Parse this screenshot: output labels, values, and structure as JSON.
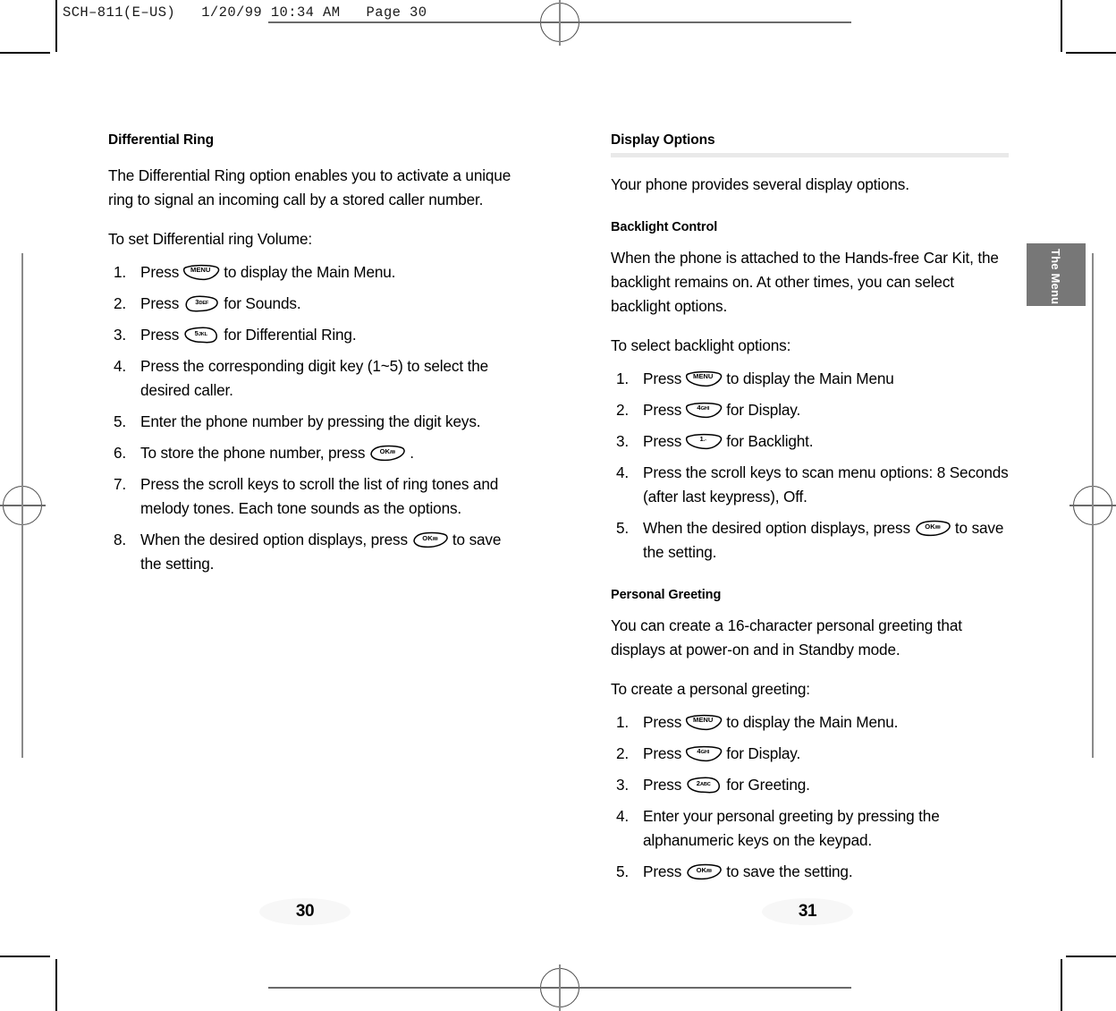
{
  "slug": "SCH–811(E–US)   1/20/99 10:34 AM   Page 30",
  "side_tab": {
    "label": "The Menu",
    "color": "#777777"
  },
  "folios": {
    "left": "30",
    "right": "31"
  },
  "keys": {
    "menu": {
      "main": "MENU",
      "sub": ""
    },
    "ok": {
      "main": "OK",
      "sub": "/✉"
    },
    "one": {
      "main": "1",
      "sub": ".-"
    },
    "two": {
      "main": "2",
      "sub": "ABC"
    },
    "three": {
      "main": "3",
      "sub": "DEF"
    },
    "four": {
      "main": "4",
      "sub": "GHI"
    },
    "five": {
      "main": "5",
      "sub": "JKL"
    }
  },
  "left_column": {
    "heading": "Differential Ring",
    "intro": "The Differential Ring option enables you to activate a unique ring to signal an incoming call by a stored caller number.",
    "lead_in": "To set Differential ring Volume:",
    "steps": [
      {
        "num": "1.",
        "before": "Press",
        "after": "to display the Main Menu."
      },
      {
        "num": "2.",
        "before": "Press",
        "after": "for Sounds."
      },
      {
        "num": "3.",
        "before": "Press",
        "after": "for Differential Ring."
      },
      {
        "num": "4.",
        "text": "Press the corresponding digit key (1~5) to select the desired caller."
      },
      {
        "num": "5.",
        "text": "Enter the phone number by pressing the digit keys."
      },
      {
        "num": "6.",
        "before": "To store the phone number, press",
        "after": "."
      },
      {
        "num": "7.",
        "text": "Press the scroll keys to scroll the list of ring tones and melody tones.  Each tone sounds as the options."
      },
      {
        "num": "8.",
        "before": "When the desired option displays, press",
        "after": "to save the setting."
      }
    ]
  },
  "right_column": {
    "heading": "Display Options",
    "intro": "Your phone provides several display options.",
    "sections": [
      {
        "subheading": "Backlight Control",
        "body": "When the phone is attached to the Hands-free Car Kit, the backlight remains on.  At other times, you can select backlight options.",
        "lead_in": "To select backlight options:",
        "steps": [
          {
            "num": "1.",
            "before": "Press",
            "after": "to display the Main Menu"
          },
          {
            "num": "2.",
            "before": "Press",
            "after": "for Display."
          },
          {
            "num": "3.",
            "before": "Press",
            "after": "for Backlight."
          },
          {
            "num": "4.",
            "text": "Press the scroll keys to scan menu options: 8 Seconds (after last keypress), Off."
          },
          {
            "num": "5.",
            "before": "When the desired option displays, press",
            "after": "to save the setting."
          }
        ]
      },
      {
        "subheading": "Personal Greeting",
        "body": "You can create a 16-character personal greeting that displays at power-on and in Standby mode.",
        "lead_in": "To create a personal greeting:",
        "steps": [
          {
            "num": "1.",
            "before": "Press",
            "after": "to display the Main Menu."
          },
          {
            "num": "2.",
            "before": "Press",
            "after": "for Display."
          },
          {
            "num": "3.",
            "before": "Press",
            "after": "for Greeting."
          },
          {
            "num": "4.",
            "text": "Enter your personal greeting by pressing the alphanumeric keys on the keypad."
          },
          {
            "num": "5.",
            "before": "Press",
            "after": "to save the setting."
          }
        ]
      }
    ]
  }
}
